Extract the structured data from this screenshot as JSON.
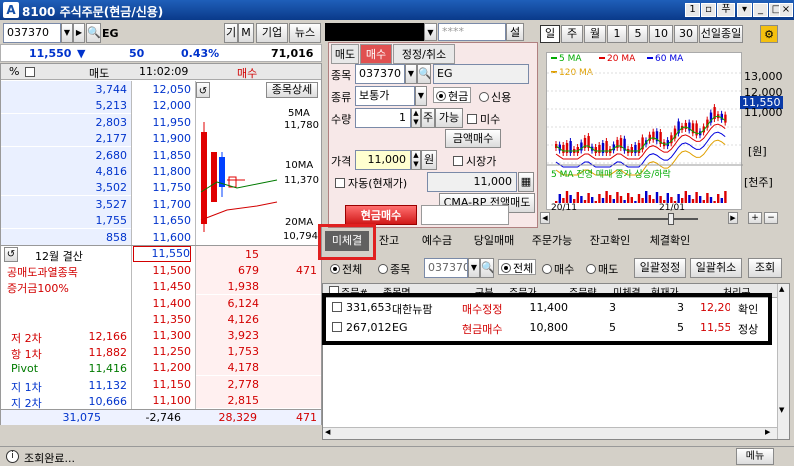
{
  "window": {
    "code": "8100",
    "title": "주식주문(현금/신용)",
    "status": "조회완료...",
    "menu_label": "메뉴"
  },
  "top": {
    "stock_code": "037370",
    "stock_name": "EG",
    "btn_gi": "기",
    "btn_m": "M",
    "btn_company": "기업",
    "btn_news": "뉴스",
    "account_masked": "",
    "password_placeholder": "****",
    "btn_set": "설"
  },
  "quote": {
    "price": "11,550",
    "arrow": "▼",
    "change": "50",
    "rate": "0.43%",
    "volume": "71,016"
  },
  "orderbook": {
    "hdr_pct": "%",
    "hdr_sell": "매도",
    "time": "11:02:09",
    "hdr_buy": "매수",
    "asks": [
      {
        "q": "3,744",
        "p": "12,050"
      },
      {
        "q": "5,213",
        "p": "12,000"
      },
      {
        "q": "2,803",
        "p": "11,950"
      },
      {
        "q": "2,177",
        "p": "11,900"
      },
      {
        "q": "2,680",
        "p": "11,850"
      },
      {
        "q": "4,816",
        "p": "11,800"
      },
      {
        "q": "3,502",
        "p": "11,750"
      },
      {
        "q": "3,527",
        "p": "11,700"
      },
      {
        "q": "1,755",
        "p": "11,650"
      },
      {
        "q": "858",
        "p": "11,600"
      }
    ],
    "side_btn": "종목상세",
    "ma5_label": "5MA",
    "ma5": "11,780",
    "ma10_label": "10MA",
    "ma10": "11,370",
    "ma20_label": "20MA",
    "ma20": "10,794",
    "settle": "12월 결산",
    "notice1": "공매도과열종목",
    "notice2": "증거금100%",
    "bids": [
      {
        "p": "11,550",
        "q": "15"
      },
      {
        "p": "11,500",
        "q": "679"
      },
      {
        "p": "11,450",
        "q": "1,938"
      },
      {
        "p": "11,400",
        "q": "6,124"
      },
      {
        "p": "11,350",
        "q": "4,126"
      },
      {
        "p": "11,300",
        "q": "3,923"
      },
      {
        "p": "11,250",
        "q": "1,753"
      },
      {
        "p": "11,200",
        "q": "4,178"
      },
      {
        "p": "11,150",
        "q": "2,778"
      },
      {
        "p": "11,100",
        "q": "2,815"
      }
    ],
    "bid_extra": "471",
    "pivots": [
      {
        "l": "저 2차",
        "v": "12,166"
      },
      {
        "l": "항 1차",
        "v": "11,882"
      },
      {
        "l": "Pivot",
        "v": "11,416"
      },
      {
        "l": "지 1차",
        "v": "11,132"
      },
      {
        "l": "지 2차",
        "v": "10,666"
      }
    ],
    "totals": {
      "sell": "31,075",
      "diff": "-2,746",
      "buy": "28,329",
      "extra": "471"
    }
  },
  "order": {
    "tabs": [
      "매도",
      "매수",
      "정정/취소"
    ],
    "lbl_code": "종목",
    "code": "037370",
    "name": "EG",
    "lbl_type": "종류",
    "type": "보통가",
    "radio_cash": "현금",
    "radio_credit": "신용",
    "lbl_qty": "수량",
    "qty": "1",
    "btn_ju": "주",
    "btn_avail": "가능",
    "chk_undecided": "미수",
    "btn_amount": "금액매수",
    "lbl_price": "가격",
    "price": "11,000",
    "btn_won": "원",
    "chk_market": "시장가",
    "chk_auto": "자동(현재가)",
    "auto_price": "11,000",
    "btn_cmarp": "CMA-RP 전액매도",
    "btn_submit": "현금매수"
  },
  "chart": {
    "periods": [
      "일",
      "주",
      "월",
      "1",
      "5",
      "10",
      "30",
      "선일종일"
    ],
    "legend": [
      {
        "name": "5 MA",
        "color": "#00aa00"
      },
      {
        "name": "20 MA",
        "color": "#dd0000"
      },
      {
        "name": "60 MA",
        "color": "#0000dd"
      },
      {
        "name": "120 MA",
        "color": "#e0a000"
      }
    ],
    "y_ticks": [
      "13,000",
      "12,000",
      "11,000"
    ],
    "price_tag": "11,550",
    "y_unit": "[원]",
    "vol_unit": "[천주]",
    "vol_legend": "5 MA 전영 매매 종가 상승/하락",
    "x_ticks": [
      "20/11",
      "21/01"
    ]
  },
  "chart_data": {
    "type": "line",
    "x": [
      "20/11",
      "21/01"
    ],
    "series": [
      {
        "name": "5 MA"
      },
      {
        "name": "20 MA"
      },
      {
        "name": "60 MA"
      },
      {
        "name": "120 MA"
      }
    ],
    "ylim": [
      10000,
      14000
    ]
  },
  "bottom": {
    "tabs": [
      "미체결",
      "잔고",
      "예수금",
      "당일매매",
      "주문가능",
      "잔고확인",
      "체결확인"
    ],
    "filter_all": "전체",
    "filter_stock": "종목",
    "filter_code": "037370",
    "f2_all": "전체",
    "f2_buy": "매수",
    "f2_sell": "매도",
    "btn_bulk_modify": "일괄정정",
    "btn_bulk_cancel": "일괄취소",
    "btn_query": "조회",
    "columns": [
      "주문#",
      "종목명",
      "구분",
      "주문가",
      "주문량",
      "미체결",
      "현재가",
      "처리구"
    ],
    "rows": [
      {
        "no": "331,653",
        "name": "대한뉴팜",
        "type": "매수정정",
        "price": "11,400",
        "qty": "3",
        "unfilled": "3",
        "cur": "12,200",
        "status": "확인"
      },
      {
        "no": "267,012",
        "name": "EG",
        "type": "현금매수",
        "price": "10,800",
        "qty": "5",
        "unfilled": "5",
        "cur": "11,550",
        "status": "정상"
      }
    ]
  }
}
